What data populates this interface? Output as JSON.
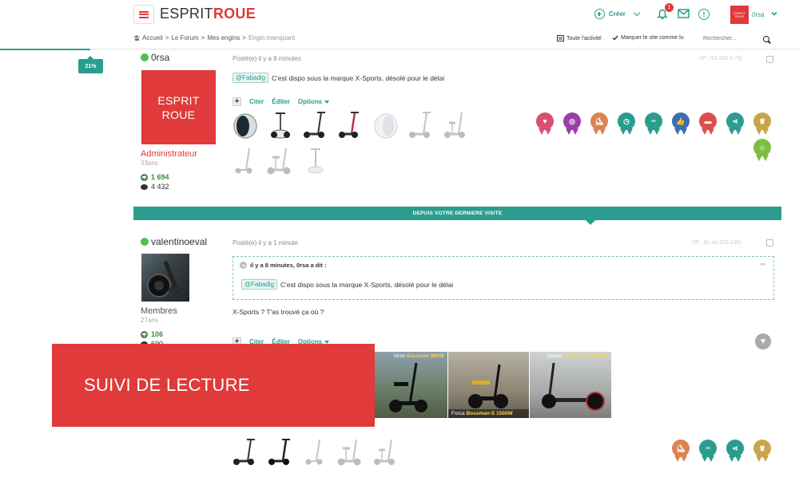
{
  "header": {
    "logo_part1": "ESPRIT",
    "logo_part2": "ROUE",
    "create_label": "Créer",
    "notification_count": "1",
    "user_avatar_line1": "ESPRIT",
    "user_avatar_line2": "ROUE",
    "username": "0rsa"
  },
  "breadcrumb": {
    "items": [
      "Accueil",
      "Le Forum",
      "Mes engins"
    ],
    "current": "Engin manquant"
  },
  "toolbar": {
    "activity_label": "Toute l'activité",
    "mark_read_label": "Marquer le site comme lu",
    "search_placeholder": "Rechercher..."
  },
  "reading_progress": {
    "label": "21%",
    "value": 21
  },
  "posts": [
    {
      "author": "0rsa",
      "posted": "Posté(e) il y a 8 minutes",
      "ip_info": "(IP : 91.159.4.79)",
      "avatar_line1": "ESPRIT",
      "avatar_line2": "ROUE",
      "role": "Administrateur",
      "age": "33ans",
      "reputation": "1 694",
      "post_count": "4 432",
      "mention": "@Fabadlg",
      "message": "C'est dispo sous la marque X-Sports, désolé pour le délai"
    },
    {
      "author": "valentinoeval",
      "posted": "Posté(e) il y a 1 minute",
      "ip_info": "(IP : 91.44.215.246)",
      "role": "Membres",
      "age": "27ans",
      "reputation": "106",
      "post_count": "690",
      "quote_header": "il y a 8 minutes, 0rsa a dit :",
      "quote_mention": "@Fabadlg",
      "quote_message": "C'est dispo sous la marque X-Sports, désolé pour le délai",
      "message": "X-Sports ? T'as trouvé ça où ?"
    }
  ],
  "actions": {
    "quote": "Citer",
    "edit": "Éditer",
    "options": "Options"
  },
  "since_last_visit": "DEPUIS VOTRE DERNIERE VISITE",
  "overlay_title": "SUIVI DE LECTURE",
  "ads": [
    {
      "brand": "Viron",
      "model": "Escooter 800W"
    },
    {
      "brand": "Forca",
      "model": "Bossman-S 1500W"
    },
    {
      "brand": "Xiaomi",
      "model": "M365 Clone 250W"
    }
  ],
  "badges_post1": [
    {
      "color": "#d94f70",
      "icon": "heart-icon"
    },
    {
      "color": "#9b3fa8",
      "icon": "ring-icon"
    },
    {
      "color": "#d9844f",
      "icon": "scooter-icon"
    },
    {
      "color": "#2a9d8f",
      "icon": "clock-icon"
    },
    {
      "color": "#2a9d8f",
      "icon": "esprit-roue-icon"
    },
    {
      "color": "#3a6fb5",
      "icon": "thumbs-up-icon"
    },
    {
      "color": "#d94f4f",
      "icon": "comment-icon"
    },
    {
      "color": "#2a9d8f",
      "icon": "share-icon"
    },
    {
      "color": "#c9a54a",
      "icon": "trophy-icon"
    },
    {
      "color": "#7cbf3f",
      "icon": "person-icon"
    }
  ],
  "badges_post2": [
    {
      "color": "#d9844f",
      "icon": "scooter-icon"
    },
    {
      "color": "#2a9d8f",
      "icon": "esprit-roue-icon"
    },
    {
      "color": "#2a9d8f",
      "icon": "share-icon"
    },
    {
      "color": "#c9a54a",
      "icon": "trophy-icon"
    }
  ],
  "colors": {
    "brand_red": "#e03a3a",
    "accent_teal": "#2a9d8f",
    "online_green": "#4cc24c"
  }
}
